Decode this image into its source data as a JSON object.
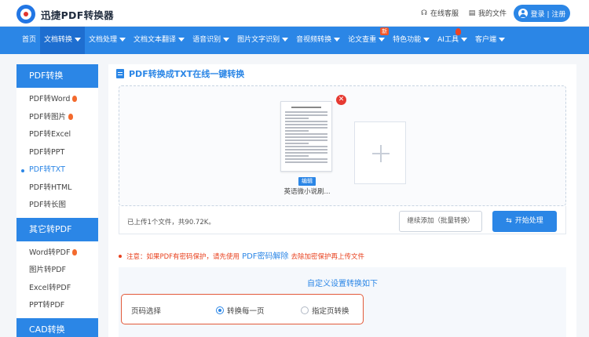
{
  "header": {
    "app_title": "迅捷PDF转换器",
    "online_service": "在线客服",
    "my_files": "我的文件",
    "login": "登录 | 注册"
  },
  "nav": {
    "items": [
      {
        "label": "首页",
        "dropdown": false
      },
      {
        "label": "文档转换",
        "dropdown": true,
        "active": true
      },
      {
        "label": "文档处理",
        "dropdown": true
      },
      {
        "label": "文档文本翻译",
        "dropdown": true
      },
      {
        "label": "语音识别",
        "dropdown": true
      },
      {
        "label": "图片文字识别",
        "dropdown": true
      },
      {
        "label": "音视频转换",
        "dropdown": true
      },
      {
        "label": "论文查重",
        "dropdown": true,
        "badge": "新"
      },
      {
        "label": "特色功能",
        "dropdown": true
      },
      {
        "label": "AI工具",
        "dropdown": true,
        "flame": true
      },
      {
        "label": "客户端",
        "dropdown": true
      }
    ]
  },
  "sidebar": {
    "section1_title": "PDF转换",
    "section1_items": [
      {
        "label": "PDF转Word",
        "hot": true
      },
      {
        "label": "PDF转图片",
        "hot": true
      },
      {
        "label": "PDF转Excel"
      },
      {
        "label": "PDF转PPT"
      },
      {
        "label": "PDF转TXT",
        "active": true
      },
      {
        "label": "PDF转HTML"
      },
      {
        "label": "PDF转长图"
      }
    ],
    "section2_title": "其它转PDF",
    "section2_items": [
      {
        "label": "Word转PDF",
        "hot": true
      },
      {
        "label": "图片转PDF"
      },
      {
        "label": "Excel转PDF"
      },
      {
        "label": "PPT转PDF"
      }
    ],
    "section3_title": "CAD转换"
  },
  "main": {
    "title": "PDF转换成TXT在线一键转换",
    "file": {
      "edit_label": "编辑",
      "name": "英语微小说刷..."
    },
    "status": "已上传1个文件，共90.72K。",
    "continue_button": "继续添加（批量转换）",
    "start_button": "开始处理",
    "notice_prefix": "注意：如果PDF有密码保护，请先使用",
    "notice_link": "PDF密码解除",
    "notice_suffix": "去除加密保护再上传文件",
    "settings_title": "自定义设置转换如下",
    "page_select_label": "页码选择",
    "option_all": "转换每一页",
    "option_range": "指定页转换"
  },
  "colors": {
    "primary": "#2b86e6",
    "danger": "#e63a32",
    "notice": "#e8411e"
  }
}
